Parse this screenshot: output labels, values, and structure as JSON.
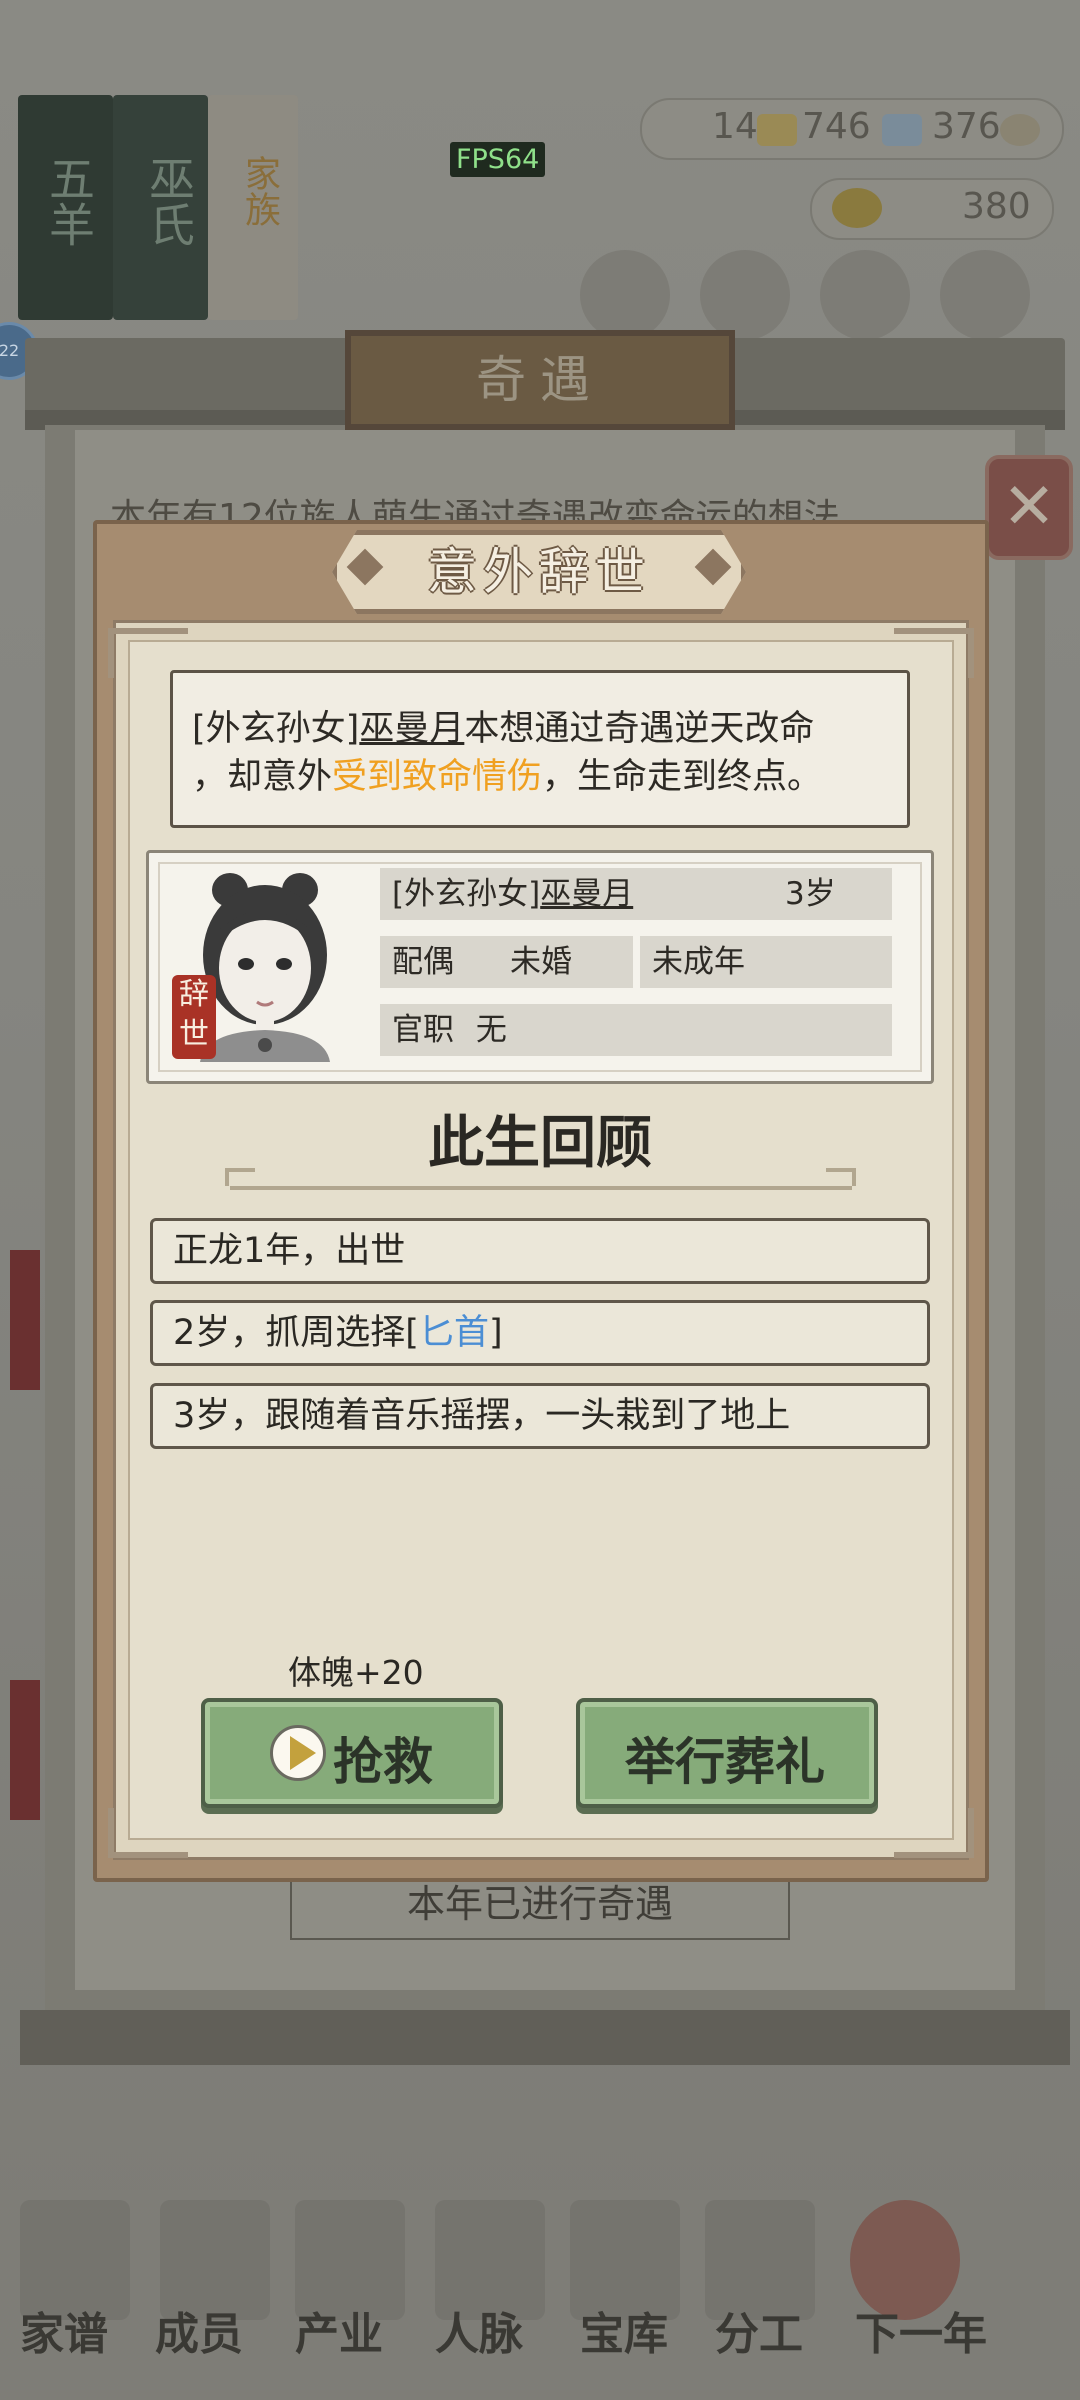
{
  "background": {
    "book_labels": [
      "五羊",
      "巫氏",
      "家族"
    ],
    "resources": [
      "14",
      "746",
      "376"
    ],
    "gold": "380",
    "fps": "FPS64",
    "side_badge": "22",
    "back_panel_title": "奇遇",
    "back_panel_intro": "本年有12位族人萌生通过奇遇改变命运的想法",
    "back_panel_status": "本年已进行奇遇",
    "nav": [
      "家谱",
      "成员",
      "产业",
      "人脉",
      "宝库",
      "分工",
      "下一年"
    ]
  },
  "dialog": {
    "title": "意外辞世",
    "message": {
      "prefix": "[外玄孙女]",
      "name": "巫曼月",
      "line1_rest": "本想通过奇遇逆天改命",
      "line2_start": "，却意外",
      "line2_highlight": "受到致命情伤",
      "line2_end": "，生命走到终点。"
    },
    "card": {
      "seal": "辞世",
      "relation": "[外玄孙女]",
      "name": "巫曼月",
      "age": "3岁",
      "spouse_label": "配偶",
      "spouse_value": "未婚",
      "adult_status": "未成年",
      "office_label": "官职",
      "office_value": "无"
    },
    "review_title": "此生回顾",
    "events": [
      {
        "text": "正龙1年，出世"
      },
      {
        "prefix": "2岁，抓周选择[",
        "item": "匕首",
        "suffix": "]"
      },
      {
        "text": "3岁，跟随着音乐摇摆，一头栽到了地上"
      }
    ],
    "reward": "体魄+20",
    "rescue_button": "抢救",
    "funeral_button": "举行葬礼"
  },
  "colors": {
    "highlight_orange": "#f0a020",
    "item_blue": "#4b8ed4",
    "button_green": "#86ab7a",
    "seal_red": "#a93226"
  }
}
